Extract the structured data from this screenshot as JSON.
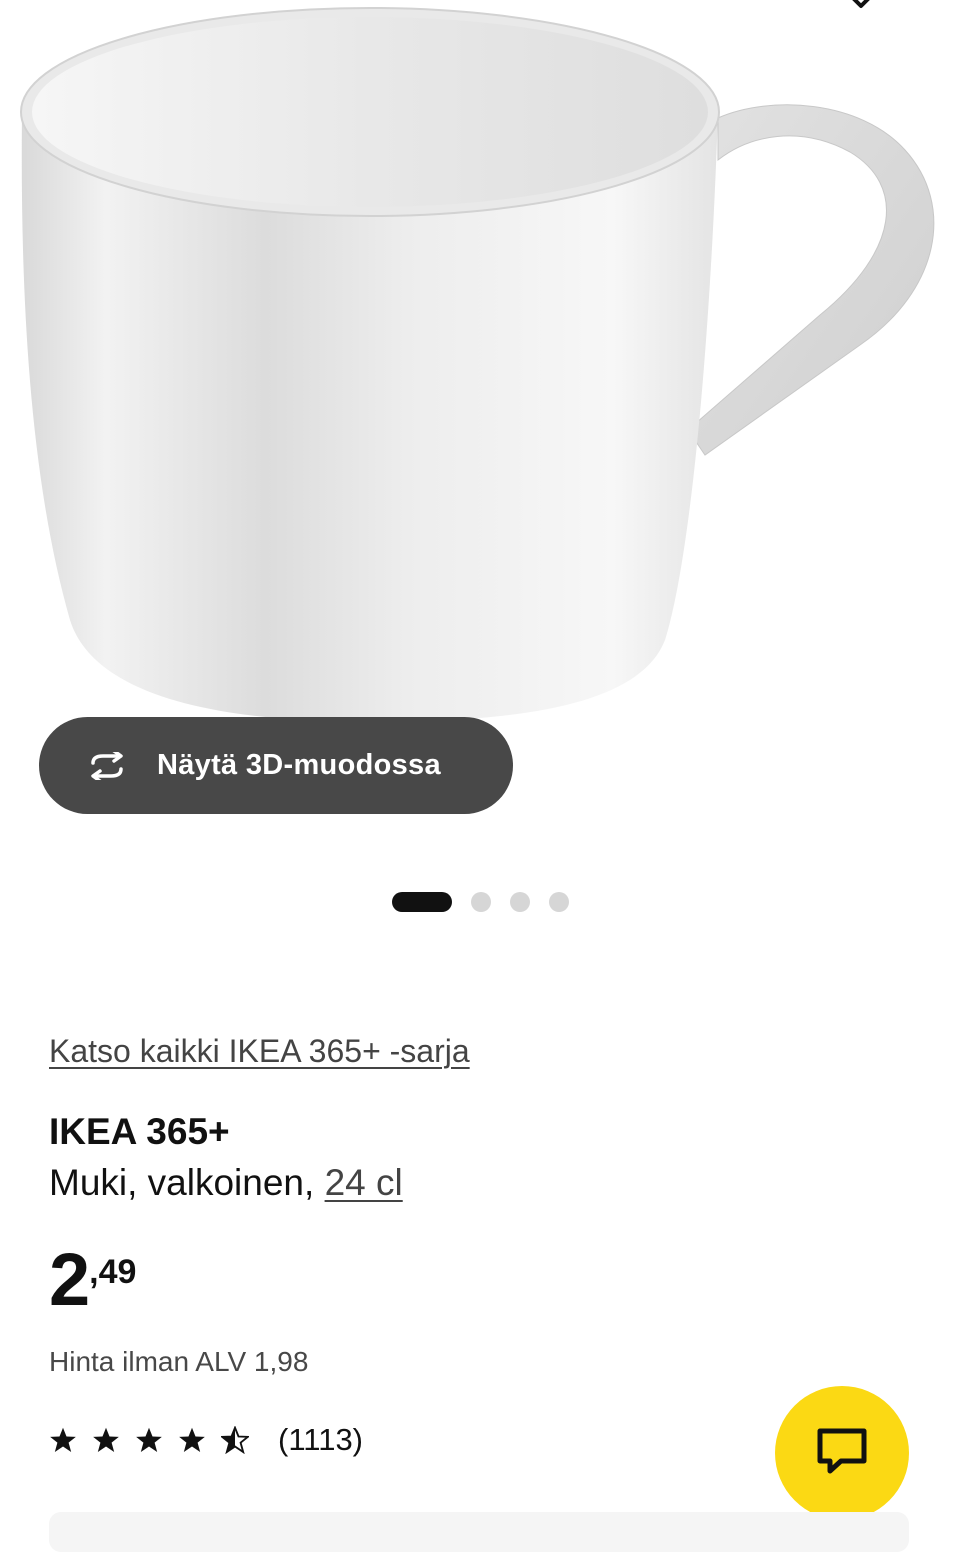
{
  "gallery": {
    "view_3d_label": "Näytä 3D-muodossa",
    "image_count": 4,
    "active_index": 0
  },
  "product": {
    "series_link": "Katso kaikki IKEA 365+ -sarja",
    "name": "IKEA 365+",
    "description": "Muki, valkoinen,",
    "size_link": "24 cl",
    "price_integer": "2",
    "price_decimals": ",49",
    "vat_text": "Hinta ilman ALV 1,98",
    "rating_stars": 4.5,
    "review_count": "(1113)"
  },
  "colors": {
    "accent_yellow": "#fbd914",
    "dark_button": "#484848",
    "text": "#111111"
  },
  "icons": {
    "favourite": "heart-icon",
    "rotate": "rotate-3d-icon",
    "star": "star-icon",
    "chat": "chat-icon"
  }
}
